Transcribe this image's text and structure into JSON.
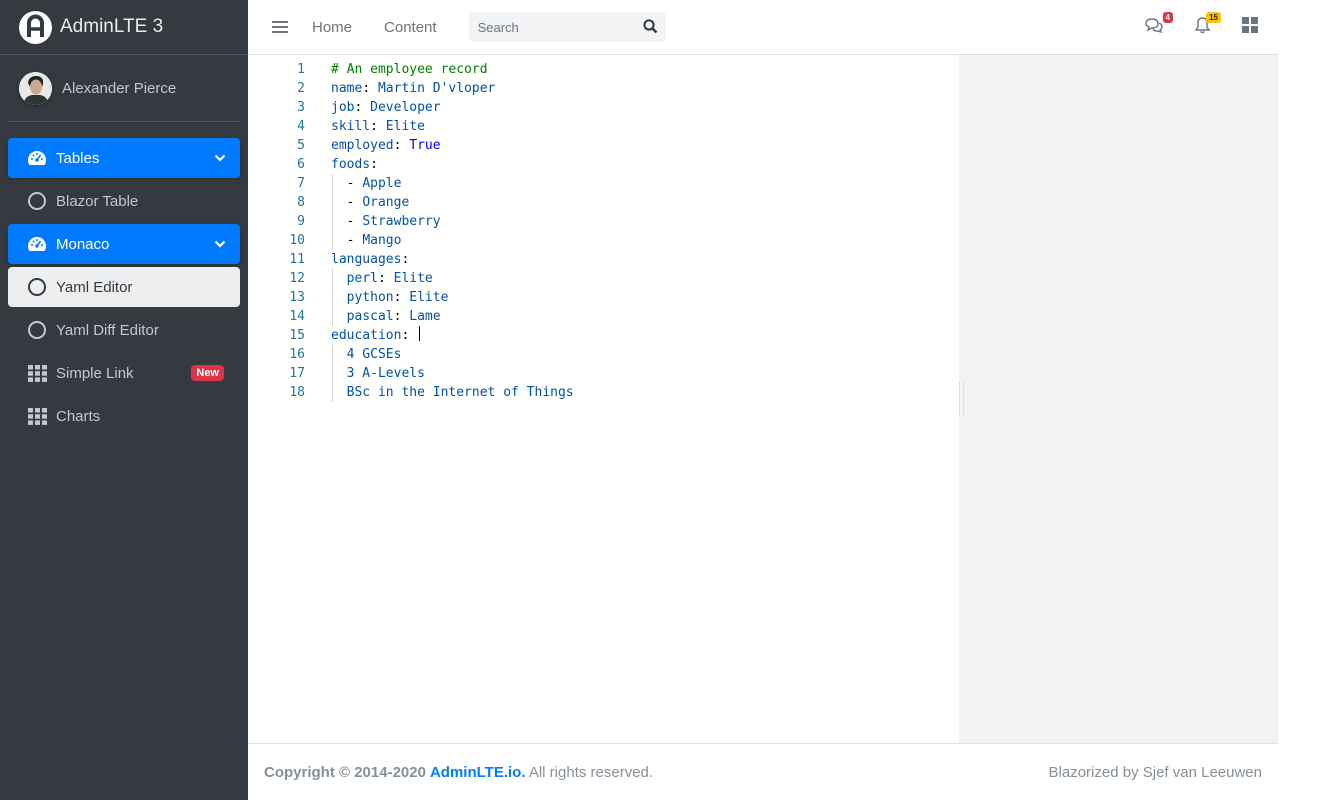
{
  "brand": {
    "title": "AdminLTE 3"
  },
  "user": {
    "name": "Alexander Pierce"
  },
  "sidebar": {
    "items": [
      {
        "label": "Tables",
        "icon": "tachometer-icon",
        "state": "active",
        "has_chevron": true
      },
      {
        "label": "Blazor Table",
        "icon": "circle-icon",
        "state": "normal"
      },
      {
        "label": "Monaco",
        "icon": "tachometer-icon",
        "state": "active",
        "has_chevron": true
      },
      {
        "label": "Yaml Editor",
        "icon": "circle-icon",
        "state": "selected"
      },
      {
        "label": "Yaml Diff Editor",
        "icon": "circle-icon",
        "state": "normal"
      },
      {
        "label": "Simple Link",
        "icon": "grid-icon",
        "state": "normal",
        "badge": "New"
      },
      {
        "label": "Charts",
        "icon": "grid-icon",
        "state": "normal"
      }
    ]
  },
  "header": {
    "links": [
      "Home",
      "Content"
    ],
    "search_placeholder": "Search",
    "messages_count": "4",
    "notifications_count": "15"
  },
  "editor": {
    "lines": [
      {
        "n": "1",
        "tokens": [
          [
            "c",
            "# An employee record"
          ]
        ]
      },
      {
        "n": "2",
        "tokens": [
          [
            "k",
            "name"
          ],
          [
            "p",
            ": "
          ],
          [
            "v",
            "Martin D'vloper"
          ]
        ]
      },
      {
        "n": "3",
        "tokens": [
          [
            "k",
            "job"
          ],
          [
            "p",
            ": "
          ],
          [
            "v",
            "Developer"
          ]
        ]
      },
      {
        "n": "4",
        "tokens": [
          [
            "k",
            "skill"
          ],
          [
            "p",
            ": "
          ],
          [
            "v",
            "Elite"
          ]
        ]
      },
      {
        "n": "5",
        "tokens": [
          [
            "k",
            "employed"
          ],
          [
            "p",
            ": "
          ],
          [
            "b",
            "True"
          ]
        ]
      },
      {
        "n": "6",
        "tokens": [
          [
            "k",
            "foods"
          ],
          [
            "p",
            ":"
          ]
        ]
      },
      {
        "n": "7",
        "tokens": [
          [
            "p",
            "  "
          ],
          [
            "p",
            "- "
          ],
          [
            "v",
            "Apple"
          ]
        ]
      },
      {
        "n": "8",
        "tokens": [
          [
            "p",
            "  "
          ],
          [
            "p",
            "- "
          ],
          [
            "v",
            "Orange"
          ]
        ]
      },
      {
        "n": "9",
        "tokens": [
          [
            "p",
            "  "
          ],
          [
            "p",
            "- "
          ],
          [
            "v",
            "Strawberry"
          ]
        ]
      },
      {
        "n": "10",
        "tokens": [
          [
            "p",
            "  "
          ],
          [
            "p",
            "- "
          ],
          [
            "v",
            "Mango"
          ]
        ]
      },
      {
        "n": "11",
        "tokens": [
          [
            "k",
            "languages"
          ],
          [
            "p",
            ":"
          ]
        ]
      },
      {
        "n": "12",
        "tokens": [
          [
            "p",
            "  "
          ],
          [
            "k",
            "perl"
          ],
          [
            "p",
            ": "
          ],
          [
            "v",
            "Elite"
          ]
        ]
      },
      {
        "n": "13",
        "tokens": [
          [
            "p",
            "  "
          ],
          [
            "k",
            "python"
          ],
          [
            "p",
            ": "
          ],
          [
            "v",
            "Elite"
          ]
        ]
      },
      {
        "n": "14",
        "tokens": [
          [
            "p",
            "  "
          ],
          [
            "k",
            "pascal"
          ],
          [
            "p",
            ": "
          ],
          [
            "v",
            "Lame"
          ]
        ]
      },
      {
        "n": "15",
        "tokens": [
          [
            "k",
            "education"
          ],
          [
            "p",
            ": "
          ],
          [
            "p",
            "|"
          ]
        ]
      },
      {
        "n": "16",
        "tokens": [
          [
            "p",
            "  "
          ],
          [
            "v",
            "4 GCSEs"
          ]
        ]
      },
      {
        "n": "17",
        "tokens": [
          [
            "p",
            "  "
          ],
          [
            "v",
            "3 A-Levels"
          ]
        ]
      },
      {
        "n": "18",
        "tokens": [
          [
            "p",
            "  "
          ],
          [
            "v",
            "BSc in the Internet of Things"
          ]
        ]
      }
    ]
  },
  "footer": {
    "copyright": "Copyright © 2014-2020 ",
    "link": "AdminLTE.io.",
    "rights": " All rights reserved.",
    "credit": "Blazorized by Sjef van Leeuwen"
  },
  "colors": {
    "sidebar_bg": "#343a40",
    "active": "#007bff",
    "badge_new": "#dc3545",
    "yaml_key": "#0451a5",
    "yaml_comment": "#008000",
    "yaml_bool": "#0000ff"
  }
}
